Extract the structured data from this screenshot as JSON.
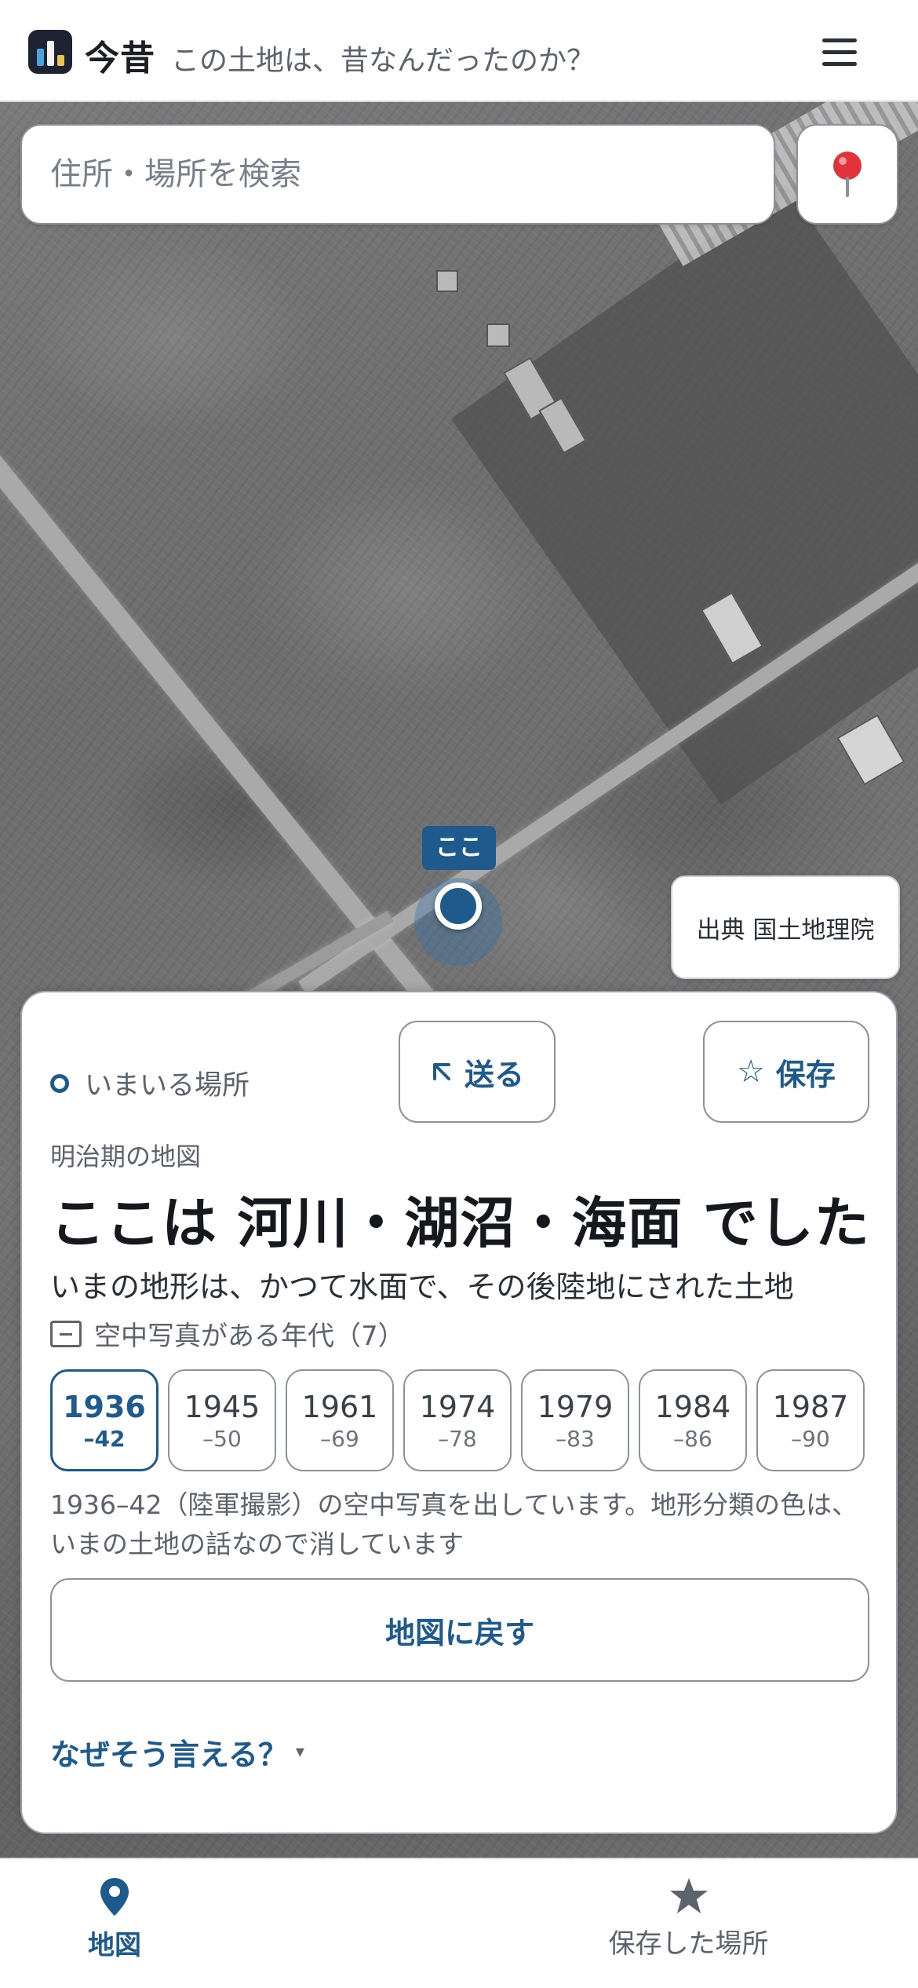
{
  "header": {
    "app_name": "今昔",
    "tagline": "この土地は、昔なんだったのか？",
    "logo_icon": "app-logo-icon",
    "menu_icon": "hamburger-menu-icon"
  },
  "search": {
    "placeholder": "住所・場所を検索",
    "locate_icon": "map-pin-icon"
  },
  "map": {
    "pin_label": "ここ",
    "attribution": "出典 国土地理院"
  },
  "card": {
    "location_label": "いまいる場所",
    "send_label": "送る",
    "send_icon": "arrow-up-left-icon",
    "save_label": "保存",
    "save_icon": "star-outline-icon",
    "period_label": "明治期の地図",
    "headline": "ここは 河川・湖沼・海面 でした",
    "description": "いまの地形は、かつて水面で、その後陸地にされた土地",
    "aerial_label": "空中写真がある年代（7）",
    "years": [
      {
        "year": "1936",
        "range": "–42",
        "active": true
      },
      {
        "year": "1945",
        "range": "–50",
        "active": false
      },
      {
        "year": "1961",
        "range": "–69",
        "active": false
      },
      {
        "year": "1974",
        "range": "–78",
        "active": false
      },
      {
        "year": "1979",
        "range": "–83",
        "active": false
      },
      {
        "year": "1984",
        "range": "–86",
        "active": false
      },
      {
        "year": "1987",
        "range": "–90",
        "active": false
      }
    ],
    "note": "1936–42（陸軍撮影）の空中写真を出しています。地形分類の色は、いまの土地の話なので消しています",
    "back_label": "地図に戻す",
    "why_label": "なぜそう言える？",
    "why_caret": "▾"
  },
  "bottom_nav": {
    "map_label": "地図",
    "saved_label": "保存した場所"
  },
  "colors": {
    "accent": "#1e5a8c",
    "text_muted": "#5c636c",
    "pin_red": "#e0343a"
  }
}
